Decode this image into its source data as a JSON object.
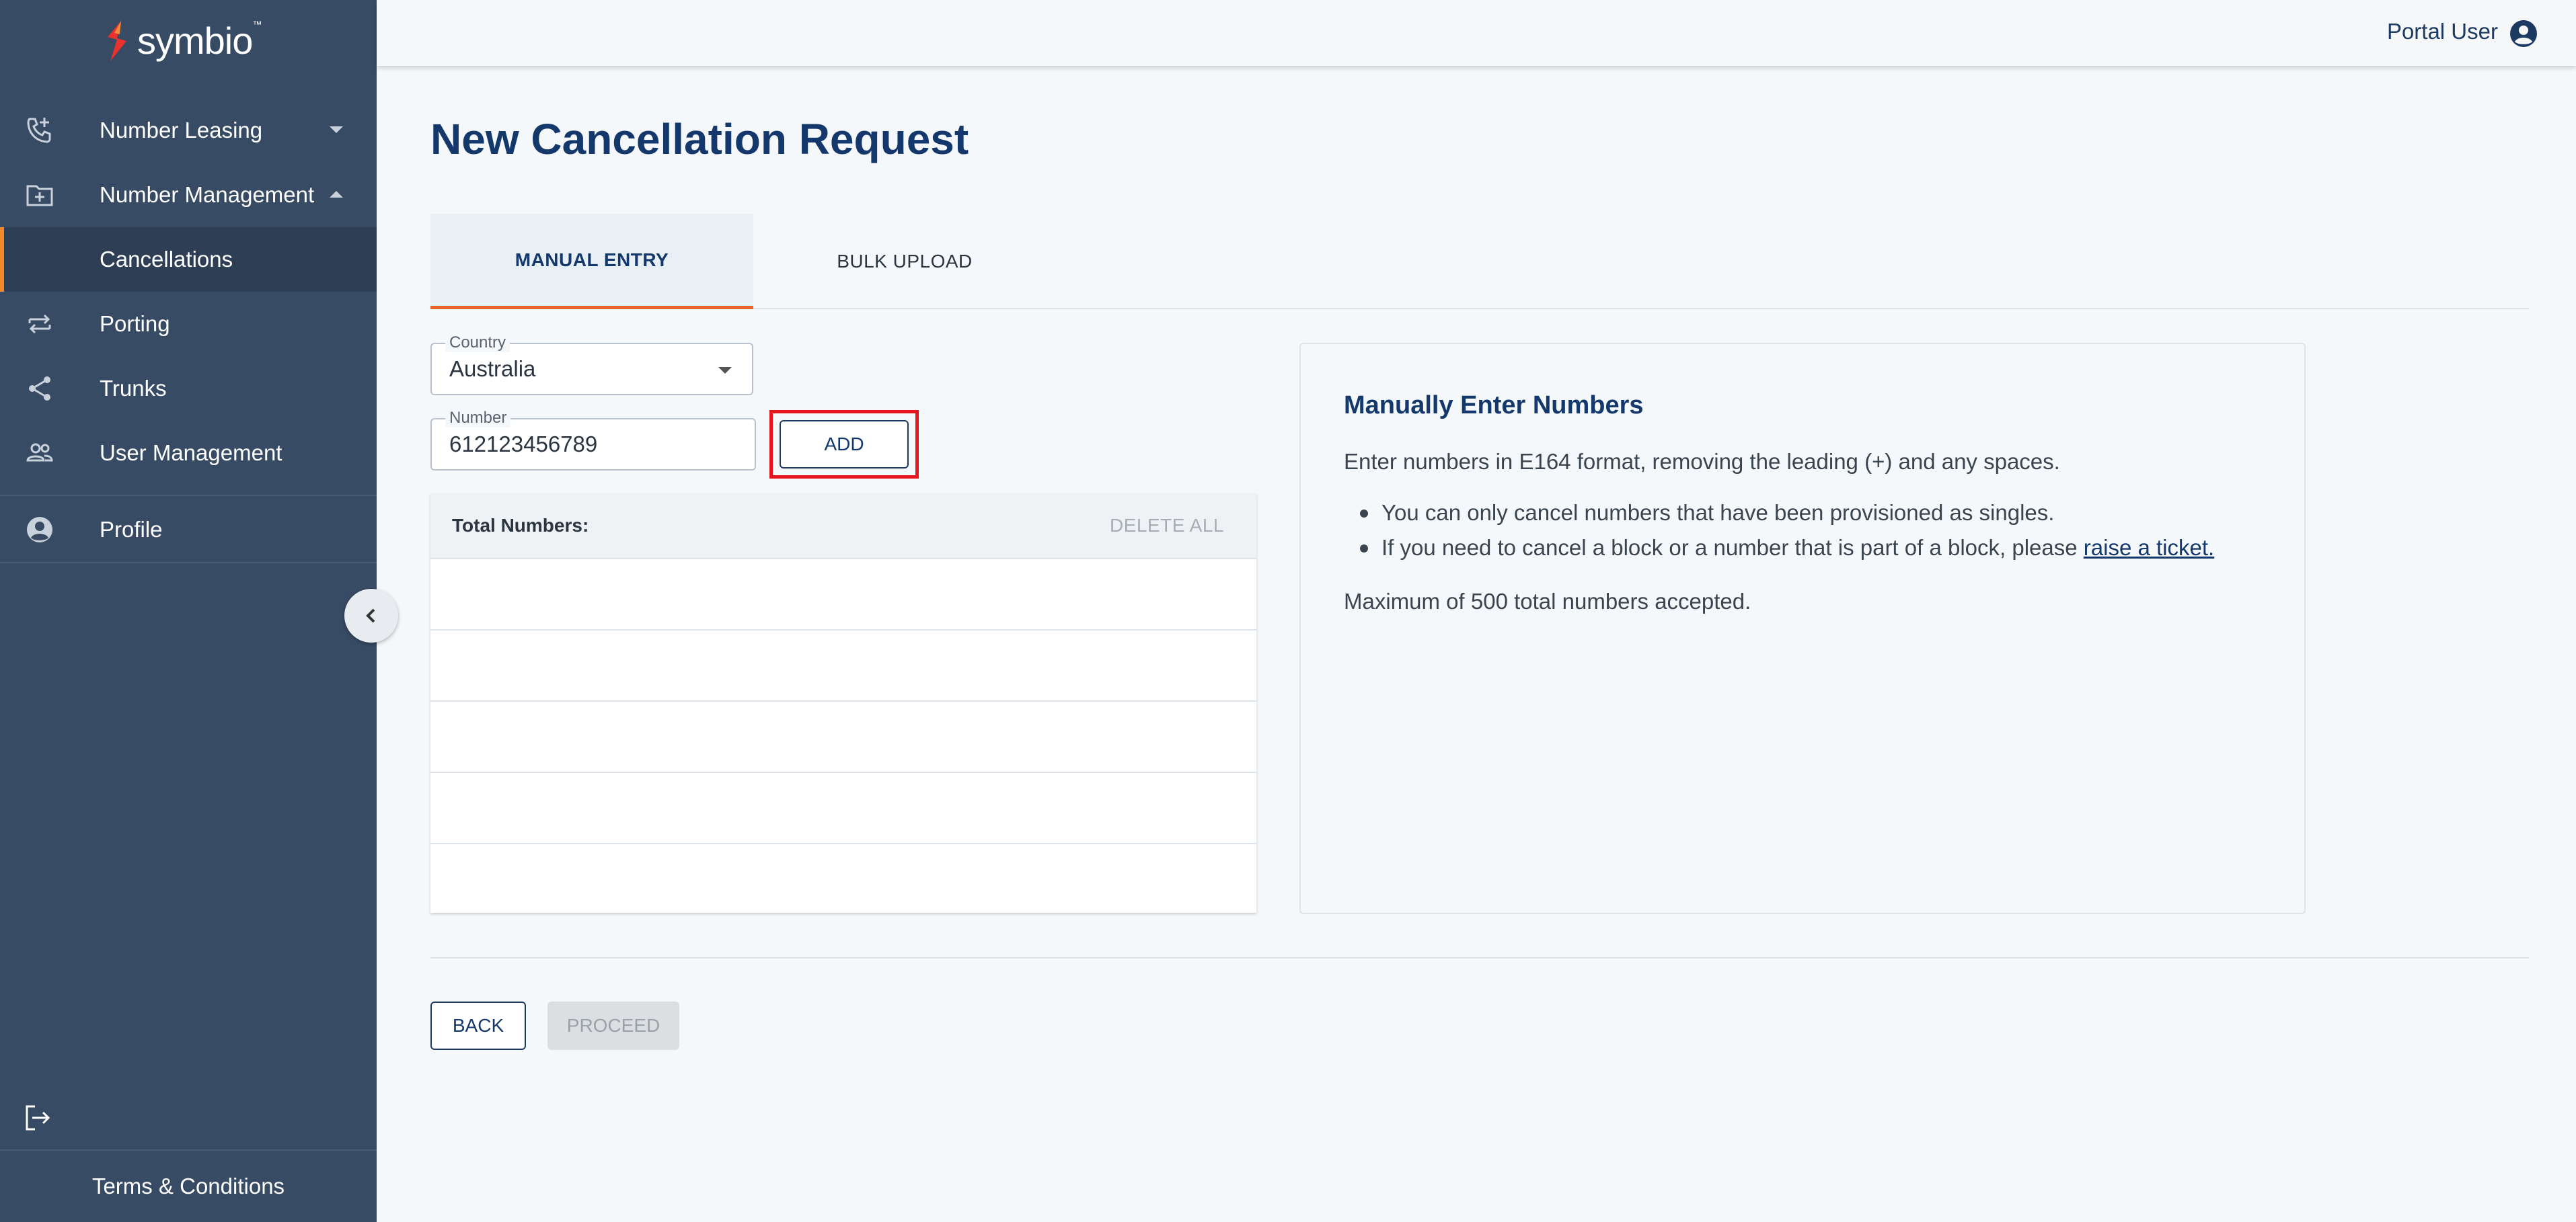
{
  "brand": {
    "name": "symbio",
    "tm": "™"
  },
  "sidebar": {
    "items": [
      {
        "label": "Number Leasing",
        "icon": "phone-add-icon"
      },
      {
        "label": "Number Management",
        "icon": "folder-add-icon"
      },
      {
        "label": "Cancellations"
      },
      {
        "label": "Porting",
        "icon": "swap-arrows-icon"
      },
      {
        "label": "Trunks",
        "icon": "share-nodes-icon"
      },
      {
        "label": "User Management",
        "icon": "users-icon"
      },
      {
        "label": "Profile",
        "icon": "account-circle-icon"
      }
    ],
    "terms": "Terms & Conditions"
  },
  "topbar": {
    "user": "Portal User"
  },
  "page": {
    "title": "New Cancellation Request"
  },
  "tabs": [
    {
      "label": "MANUAL ENTRY"
    },
    {
      "label": "BULK UPLOAD"
    }
  ],
  "form": {
    "country_label": "Country",
    "country_value": "Australia",
    "number_label": "Number",
    "number_value": "612123456789",
    "add_label": "ADD"
  },
  "numbers_table": {
    "header": "Total Numbers:",
    "delete_all": "DELETE ALL"
  },
  "info": {
    "title": "Manually Enter Numbers",
    "intro": "Enter numbers in E164 format, removing the leading (+) and any spaces.",
    "bullet1": "You can only cancel numbers that have been provisioned as singles.",
    "bullet2_prefix": "If you need to cancel a block or a number that is part of a block, please ",
    "bullet2_link": "raise a ticket.",
    "max": "Maximum of 500 total numbers accepted."
  },
  "actions": {
    "back": "BACK",
    "proceed": "PROCEED"
  },
  "colors": {
    "sidebar": "#384b64",
    "accent": "#e8632b",
    "primary": "#14386b",
    "highlight": "#e5141d"
  }
}
